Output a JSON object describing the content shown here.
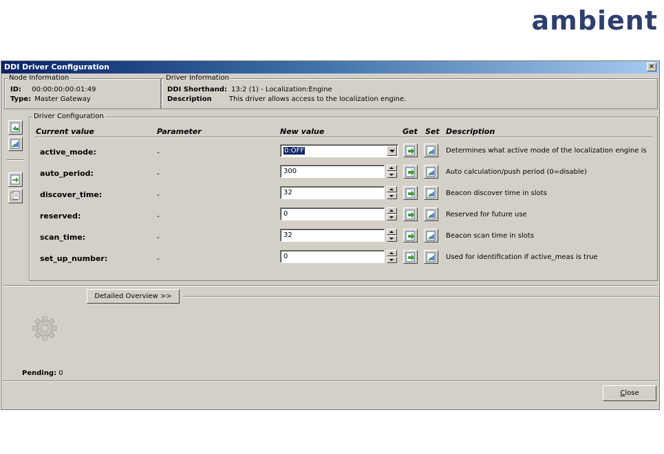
{
  "logo": {
    "text": "ambient"
  },
  "window": {
    "title": "DDI Driver Configuration",
    "close_glyph": "✕"
  },
  "node_info": {
    "legend": "Node Information",
    "id_label": "ID:",
    "id_value": "00:00:00:00:01:49",
    "type_label": "Type:",
    "type_value": "Master Gateway"
  },
  "driver_info": {
    "legend": "Driver Information",
    "shorthand_label": "DDI Shorthand:",
    "shorthand_value": "13:2 (1) - Localization:Engine",
    "description_label": "Description",
    "description_value": "This driver allows access to the localization engine."
  },
  "driver_config": {
    "legend": "Driver Configuration",
    "headers": {
      "current_value": "Current value",
      "parameter": "Parameter",
      "new_value": "New value",
      "get": "Get",
      "set": "Set",
      "description": "Description"
    },
    "rows": [
      {
        "name": "active_mode:",
        "parameter": "-",
        "value": "0:OFF",
        "kind": "dropdown",
        "description": "Determines what active mode of the localization engine is"
      },
      {
        "name": "auto_period:",
        "parameter": "-",
        "value": "300",
        "kind": "spin",
        "description": "Auto calculation/push period (0=disable)"
      },
      {
        "name": "discover_time:",
        "parameter": "-",
        "value": "32",
        "kind": "spin",
        "description": "Beacon discover time in slots"
      },
      {
        "name": "reserved:",
        "parameter": "-",
        "value": "0",
        "kind": "spin",
        "description": "Reserved for future use"
      },
      {
        "name": "scan_time:",
        "parameter": "-",
        "value": "32",
        "kind": "spin",
        "description": "Beacon scan time in slots"
      },
      {
        "name": "set_up_number:",
        "parameter": "-",
        "value": "0",
        "kind": "spin",
        "description": "Used for identification if active_meas is true"
      }
    ]
  },
  "detailed_overview_label": "Detailed Overview >>",
  "pending": {
    "label": "Pending:",
    "value": "0"
  },
  "close_button": {
    "label_prefix": "",
    "label_underlined": "C",
    "label_rest": "lose"
  },
  "icons": {
    "side_buttons": [
      "get-all-icon",
      "set-all-icon",
      "import-icon",
      "export-icon"
    ],
    "busy_indicator": "gear-icon"
  },
  "colors": {
    "titlebar_start": "#0a246a",
    "titlebar_end": "#a6caf0",
    "logo": "#2e3f6e",
    "icon_green": "#3fa03a",
    "icon_blue": "#5b86c4"
  }
}
